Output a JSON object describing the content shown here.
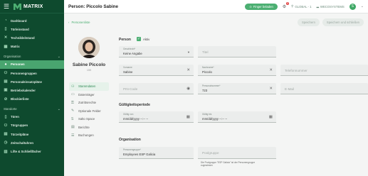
{
  "app": {
    "name": "MATRIX"
  },
  "sidebar": {
    "items_top": [
      {
        "label": "Dashboard",
        "icon": "speedometer-icon"
      },
      {
        "label": "Türleinstand",
        "icon": "door-icon"
      },
      {
        "label": "Technikleitstand",
        "icon": "tools-icon"
      },
      {
        "label": "Matrix",
        "icon": "grid-icon"
      }
    ],
    "section_org": "Organisation",
    "items_org": [
      {
        "label": "Personen",
        "icon": "person-icon",
        "active": true
      },
      {
        "label": "Personengruppen",
        "icon": "group-icon"
      },
      {
        "label": "Personaleinsatzpläne",
        "icon": "schedule-icon"
      },
      {
        "label": "Betriebskalender",
        "icon": "calendar-icon"
      },
      {
        "label": "Blockierliste",
        "icon": "block-icon"
      }
    ],
    "section_sites": "Standorte",
    "items_sites": [
      {
        "label": "Türen",
        "icon": "door-icon"
      },
      {
        "label": "Türgruppen",
        "icon": "door-group-icon"
      },
      {
        "label": "Türzeitpläne",
        "icon": "door-schedule-icon"
      },
      {
        "label": "Zeitschaltuhren",
        "icon": "clock-icon"
      },
      {
        "label": "Lifte & Schließfächer",
        "icon": "locker-icon"
      }
    ]
  },
  "topbar": {
    "title": "Person: Piccolo Sabine",
    "finger_button": "Finger beladen",
    "notif_count": "0",
    "global_label": "GLOBAL - 1",
    "system_label": "WECOSYSTEMS",
    "user_initial": "S"
  },
  "subbar": {
    "back_label": "Personenliste",
    "save_label": "Speichern",
    "save_close_label": "Speichern und schließen"
  },
  "profile": {
    "name": "Sabine Piccolo",
    "id": "159"
  },
  "menu": [
    {
      "label": "Stammdaten",
      "icon": "person-card-icon",
      "active": true
    },
    {
      "label": "Datenträger",
      "icon": "card-icon"
    },
    {
      "label": "Zutrittsrechte",
      "icon": "key-icon"
    },
    {
      "label": "Optionale Felder",
      "icon": "pencil-icon"
    },
    {
      "label": "Salto Space",
      "icon": "salto-icon"
    },
    {
      "label": "Berichte",
      "icon": "report-icon"
    },
    {
      "label": "Buchungen",
      "icon": "list-icon"
    }
  ],
  "form": {
    "person_title": "Person",
    "active_label": "Aktiv",
    "gender": {
      "label": "Geschlecht*",
      "value": "Keine Angabe"
    },
    "title_field": {
      "placeholder": "Titel"
    },
    "firstname": {
      "label": "Vorname",
      "value": "Sabine"
    },
    "lastname": {
      "label": "Nachname*",
      "value": "Piccolo"
    },
    "phone": {
      "placeholder": "Telefonnummer"
    },
    "pin": {
      "placeholder": "PIN-Code"
    },
    "personnel_no": {
      "label": "Personalnummer*",
      "value": "723"
    },
    "email": {
      "placeholder": "E-Mail"
    },
    "validity_title": "Gültigkeitsperiode",
    "valid_from": {
      "label": "Gültig von",
      "value": "mm/dd/yyyy --:-- --"
    },
    "valid_to": {
      "label": "Gültig bis",
      "value": "mm/dd/yyyy --:-- --"
    },
    "org_title": "Organisation",
    "person_group": {
      "label": "Personengruppe*",
      "value": "Employees ESP Galicia"
    },
    "person_group_b": {
      "placeholder": "Poolgruppe"
    },
    "group_hint": "Die Poolgruppe \"ESP Galicia\" ist der Personengruppe zugewiesen"
  }
}
